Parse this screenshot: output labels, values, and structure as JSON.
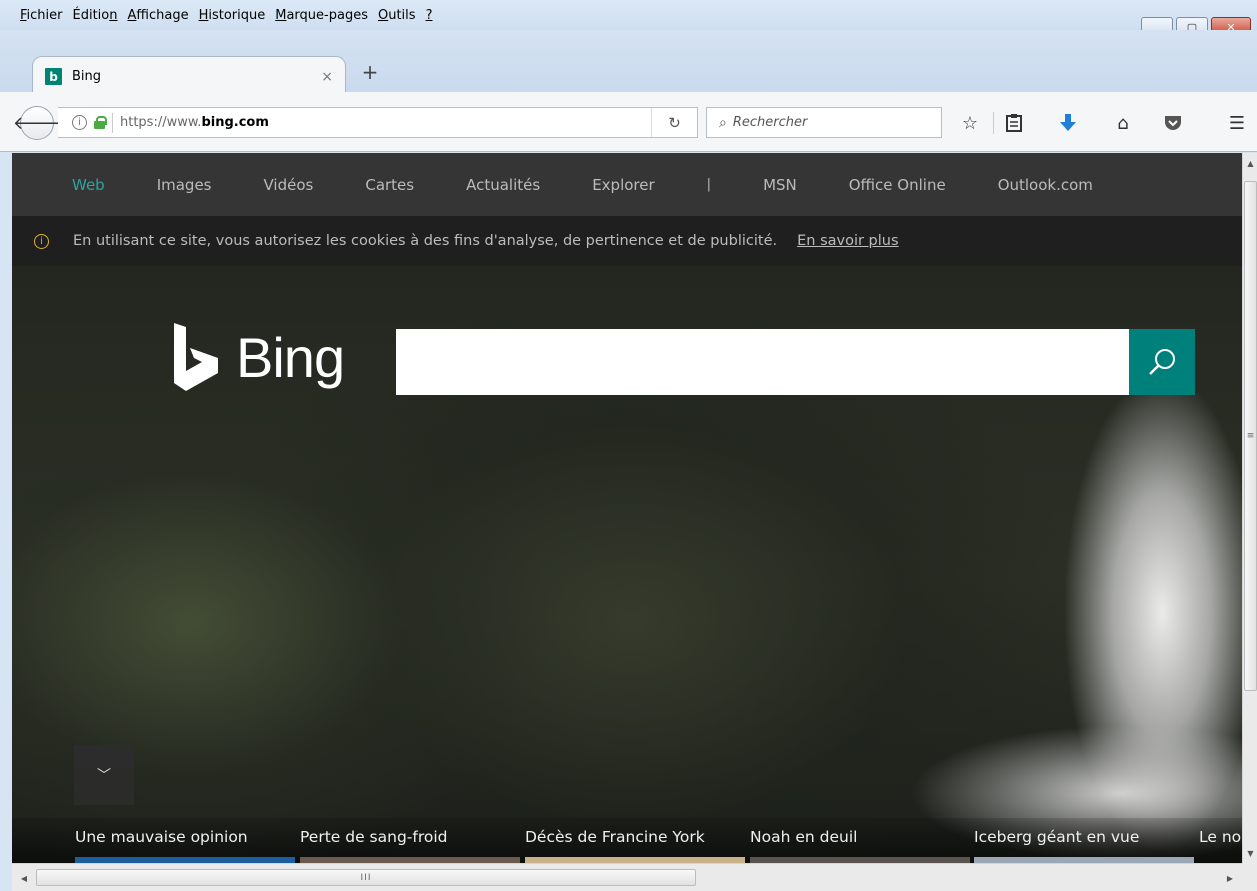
{
  "menu": [
    {
      "pre": "",
      "u": "F",
      "post": "ichier"
    },
    {
      "pre": "Éditio",
      "u": "n",
      "post": ""
    },
    {
      "pre": "",
      "u": "A",
      "post": "ffichage"
    },
    {
      "pre": "",
      "u": "H",
      "post": "istorique"
    },
    {
      "pre": "",
      "u": "M",
      "post": "arque-pages"
    },
    {
      "pre": "",
      "u": "O",
      "post": "utils"
    },
    {
      "pre": "",
      "u": "?",
      "post": ""
    }
  ],
  "tab": {
    "favicon": "b",
    "title": "Bing",
    "close": "×",
    "new_tab": "+"
  },
  "urlbar": {
    "url_prefix": "https://www.",
    "url_domain": "bing.com"
  },
  "search": {
    "placeholder": "Rechercher"
  },
  "bing": {
    "nav": [
      "Web",
      "Images",
      "Vidéos",
      "Cartes",
      "Actualités",
      "Explorer",
      "MSN",
      "Office Online",
      "Outlook.com"
    ],
    "nav_separator": "|",
    "cookie_text": "En utilisant ce site, vous autorisez les cookies à des fins d'analyse, de pertinence et de publicité.",
    "cookie_link": "En savoir plus",
    "logo_text": "Bing",
    "news": [
      "Une mauvaise opinion",
      "Perte de sang-froid",
      "Décès de Francine York",
      "Noah en deuil",
      "Iceberg géant en vue",
      "Le no"
    ]
  },
  "colors": {
    "accent": "#00807a",
    "active_nav": "#2fa39a"
  }
}
